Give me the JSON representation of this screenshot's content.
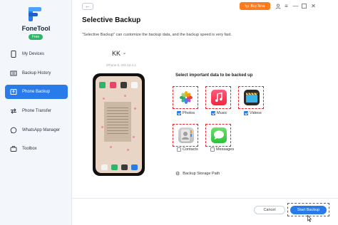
{
  "app": {
    "name": "FoneTool",
    "edition": "Free"
  },
  "sidebar": {
    "items": [
      {
        "label": "My Devices",
        "icon": "phone-icon",
        "active": false
      },
      {
        "label": "Backup History",
        "icon": "history-icon",
        "active": false
      },
      {
        "label": "Phone Backup",
        "icon": "backup-icon",
        "active": true
      },
      {
        "label": "Phone Transfer",
        "icon": "transfer-icon",
        "active": false
      },
      {
        "label": "WhatsApp Manager",
        "icon": "chat-icon",
        "active": false
      },
      {
        "label": "Toolbox",
        "icon": "toolbox-icon",
        "active": false
      }
    ]
  },
  "header": {
    "back_icon": "back-arrow-icon",
    "buy_label": "Buy Now",
    "title": "Selective Backup",
    "description": "\"Selective Backup\" can customize the backup data, and the backup speed is very fast."
  },
  "device": {
    "name": "KK",
    "model": "iPhone 6, iOS 12.4.1"
  },
  "selection": {
    "title": "Select important data to be backed up",
    "items": [
      {
        "label": "Photos",
        "icon": "photos-icon",
        "checked": true
      },
      {
        "label": "Music",
        "icon": "music-icon",
        "checked": true
      },
      {
        "label": "Videos",
        "icon": "videos-icon",
        "checked": true
      },
      {
        "label": "Contacts",
        "icon": "contacts-icon",
        "checked": false
      },
      {
        "label": "Messages",
        "icon": "messages-icon",
        "checked": false
      }
    ]
  },
  "storage_path_label": "Backup Storage Path",
  "footer": {
    "cancel_label": "Cancel",
    "start_label": "Start Backup"
  },
  "colors": {
    "accent": "#2a7bea",
    "buy": "#ff7a1a",
    "highlight": "#e2262b",
    "free_badge": "#2fb56a"
  }
}
